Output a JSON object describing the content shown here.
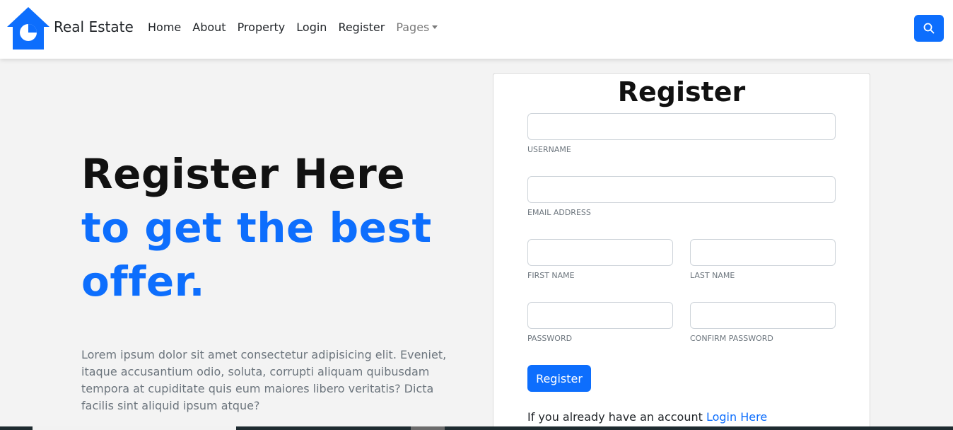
{
  "brand": {
    "name": "Real Estate",
    "logo_icon": "house-pie-logo-icon"
  },
  "nav": {
    "items": [
      "Home",
      "About",
      "Property",
      "Login",
      "Register"
    ],
    "pages_label": "Pages",
    "search_icon": "search-icon"
  },
  "hero": {
    "line1": "Register Here",
    "line2": "to get the best",
    "line3": "offer.",
    "paragraph": "Lorem ipsum dolor sit amet consectetur adipisicing elit. Eveniet, itaque accusantium odio, soluta, corrupti aliquam quibusdam tempora at cupiditate quis eum maiores libero veritatis? Dicta facilis sint aliquid ipsum atque?"
  },
  "form": {
    "title": "Register",
    "username_label": "USERNAME",
    "email_label": "EMAIL ADDRESS",
    "first_name_label": "FIRST NAME",
    "last_name_label": "LAST NAME",
    "password_label": "PASSWORD",
    "confirm_password_label": "CONFIRM PASSWORD",
    "submit_label": "Register",
    "account_prompt": "If you already have an account",
    "login_link": "Login Here"
  },
  "colors": {
    "accent": "#0d6efd",
    "background": "#f3f3f3",
    "navbar": "#ffffff"
  }
}
